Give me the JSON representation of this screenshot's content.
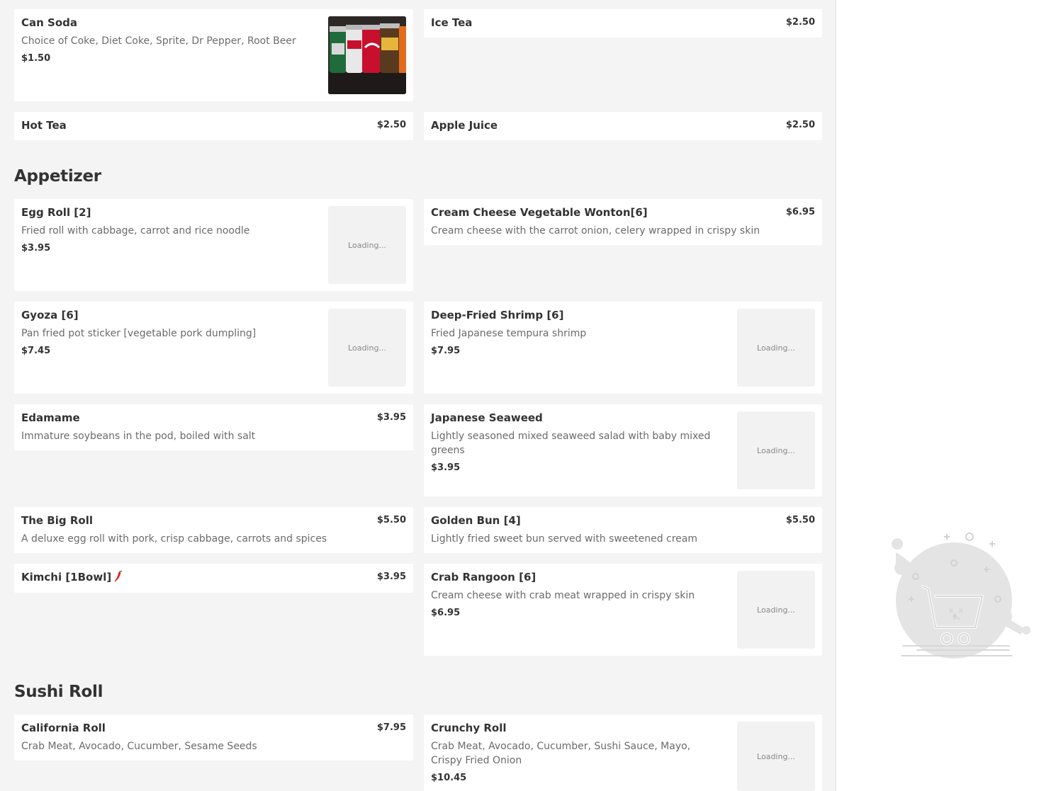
{
  "ui": {
    "loading_text": "Loading..."
  },
  "sections": [
    {
      "title": "",
      "items": [
        {
          "name": "Can Soda",
          "description": "Choice of Coke, Diet Coke, Sprite, Dr Pepper, Root Beer",
          "price": "$1.50",
          "image": "soda-cans-photo"
        },
        {
          "name": "Ice Tea",
          "price": "$2.50"
        },
        {
          "name": "Hot Tea",
          "price": "$2.50"
        },
        {
          "name": "Apple Juice",
          "price": "$2.50"
        }
      ]
    },
    {
      "title": "Appetizer",
      "items": [
        {
          "name": "Egg Roll [2]",
          "description": "Fried roll with cabbage, carrot and rice noodle",
          "price": "$3.95",
          "image": "loading"
        },
        {
          "name": "Cream Cheese Vegetable Wonton[6]",
          "description": "Cream cheese with the carrot onion, celery wrapped in crispy skin",
          "price": "$6.95"
        },
        {
          "name": "Gyoza [6]",
          "description": "Pan fried pot sticker [vegetable pork dumpling]",
          "price": "$7.45",
          "image": "loading"
        },
        {
          "name": "Deep-Fried Shrimp [6]",
          "description": "Fried Japanese tempura shrimp",
          "price": "$7.95",
          "image": "loading"
        },
        {
          "name": "Edamame",
          "description": "Immature soybeans in the pod, boiled with salt",
          "price": "$3.95"
        },
        {
          "name": "Japanese Seaweed",
          "description": "Lightly seasoned mixed seaweed salad with baby mixed greens",
          "price": "$3.95",
          "image": "loading"
        },
        {
          "name": "The Big Roll",
          "description": "A deluxe egg roll with pork, crisp cabbage, carrots and spices",
          "price": "$5.50"
        },
        {
          "name": "Golden Bun [4]",
          "description": "Lightly fried sweet bun served with sweetened cream",
          "price": "$5.50"
        },
        {
          "name": "Kimchi [1Bowl]",
          "price": "$3.95",
          "icon": "chili-pepper-icon"
        },
        {
          "name": "Crab Rangoon [6]",
          "description": "Cream cheese with crab meat wrapped in crispy skin",
          "price": "$6.95",
          "image": "loading"
        }
      ]
    },
    {
      "title": "Sushi Roll",
      "items": [
        {
          "name": "California Roll",
          "description": "Crab Meat, Avocado, Cucumber, Sesame Seeds",
          "price": "$7.95"
        },
        {
          "name": "Crunchy Roll",
          "description": "Crab Meat, Avocado, Cucumber, Sushi Sauce, Mayo, Crispy Fried Onion",
          "price": "$10.45",
          "image": "loading"
        }
      ]
    }
  ],
  "cart": {
    "state": "empty",
    "illustration": "empty-cart-illustration"
  }
}
